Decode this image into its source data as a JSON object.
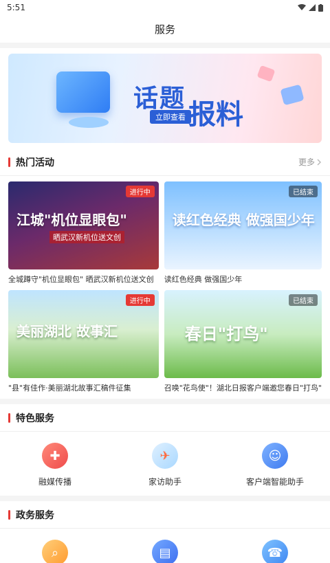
{
  "status_bar": {
    "time": "5:51"
  },
  "header": {
    "title": "服务"
  },
  "banner": {
    "title_a": "话题",
    "title_b": "报料",
    "subtitle": "立即查看"
  },
  "hot": {
    "title": "热门活动",
    "more": "更多",
    "cards": [
      {
        "title": "全城蹲守\"机位显眼包\" 晒武汉新机位送文创",
        "status": "进行中",
        "image_text": "江城\"机位显眼包\"",
        "image_sub": "晒武汉新机位送文创"
      },
      {
        "title": "读红色经典 做强国少年",
        "status": "已结束",
        "image_text": "读红色经典 做强国少年",
        "image_sub": ""
      },
      {
        "title": "\"县\"有佳作·美丽湖北故事汇稿件征集",
        "status": "进行中",
        "image_text": "美丽湖北 故事汇",
        "image_sub": ""
      },
      {
        "title": "召唤\"花鸟使\"！湖北日报客户端邀您春日\"打鸟\"",
        "status": "已结束",
        "image_text": "春日\"打鸟\"",
        "image_sub": ""
      }
    ]
  },
  "featured": {
    "title": "特色服务",
    "items": [
      {
        "label": "融媒传播",
        "icon": "broadcast-icon"
      },
      {
        "label": "家访助手",
        "icon": "swallow-icon"
      },
      {
        "label": "客户端智能助手",
        "icon": "robot-icon"
      }
    ]
  },
  "gov": {
    "title": "政务服务",
    "items": [
      {
        "label": "",
        "icon": "search-doc-icon"
      },
      {
        "label": "",
        "icon": "document-icon"
      },
      {
        "label": "",
        "icon": "hotline-12315-icon"
      }
    ]
  }
}
